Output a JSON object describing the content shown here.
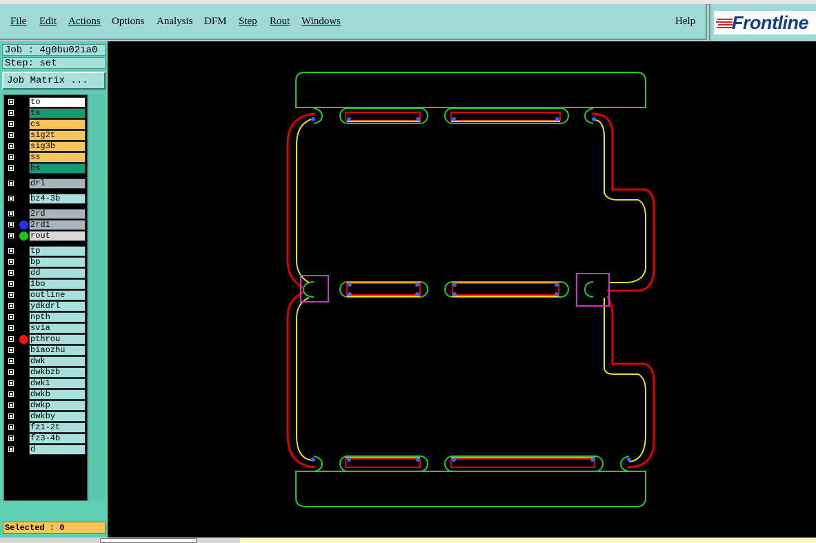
{
  "menu": {
    "file": "File",
    "edit": "Edit",
    "actions": "Actions",
    "options": "Options",
    "analysis": "Analysis",
    "dfm": "DFM",
    "step": "Step",
    "rout": "Rout",
    "windows": "Windows",
    "help": "Help"
  },
  "logo": {
    "text": "Frontline"
  },
  "job": {
    "job_label": "Job : 4g0bu02ia0",
    "step_label": "Step: set",
    "matrix_button": "Job Matrix ..."
  },
  "layers": [
    {
      "name": "to",
      "bg": "#ffffff",
      "dot": ""
    },
    {
      "name": "ts",
      "bg": "#159a72",
      "dot": ""
    },
    {
      "name": "cs",
      "bg": "#f8c45c",
      "dot": ""
    },
    {
      "name": "sig2t",
      "bg": "#f8c45c",
      "dot": ""
    },
    {
      "name": "sig3b",
      "bg": "#f8c45c",
      "dot": ""
    },
    {
      "name": "ss",
      "bg": "#f8c45c",
      "dot": ""
    },
    {
      "name": "bs",
      "bg": "#159a72",
      "dot": ""
    },
    {
      "name": "drl",
      "bg": "#a6b6ba",
      "dot": ""
    },
    {
      "name": "bz4-3b",
      "bg": "#a8e0dd",
      "dot": ""
    },
    {
      "name": "2rd",
      "bg": "#a6b6ba",
      "dot": ""
    },
    {
      "name": "2rd1",
      "bg": "#a6b6ba",
      "dot": "#2233ff"
    },
    {
      "name": "rout",
      "bg": "#d9d9d9",
      "dot": "#11cc11"
    },
    {
      "name": "tp",
      "bg": "#a8e0dd",
      "dot": ""
    },
    {
      "name": "bp",
      "bg": "#a8e0dd",
      "dot": ""
    },
    {
      "name": "dd",
      "bg": "#a8e0dd",
      "dot": ""
    },
    {
      "name": "1bo",
      "bg": "#a8e0dd",
      "dot": ""
    },
    {
      "name": "outline",
      "bg": "#a8e0dd",
      "dot": ""
    },
    {
      "name": "ydkdrl",
      "bg": "#a8e0dd",
      "dot": ""
    },
    {
      "name": "npth",
      "bg": "#a8e0dd",
      "dot": ""
    },
    {
      "name": "svia",
      "bg": "#a8e0dd",
      "dot": ""
    },
    {
      "name": "pthrou",
      "bg": "#a8e0dd",
      "dot": "#ff1111"
    },
    {
      "name": "biaozhu",
      "bg": "#a8e0dd",
      "dot": ""
    },
    {
      "name": "dwk",
      "bg": "#a8e0dd",
      "dot": ""
    },
    {
      "name": "dwkbzb",
      "bg": "#a8e0dd",
      "dot": ""
    },
    {
      "name": "dwk1",
      "bg": "#a8e0dd",
      "dot": ""
    },
    {
      "name": "dwkb",
      "bg": "#a8e0dd",
      "dot": ""
    },
    {
      "name": "dwkp",
      "bg": "#a8e0dd",
      "dot": ""
    },
    {
      "name": "dwkby",
      "bg": "#a8e0dd",
      "dot": ""
    },
    {
      "name": "fz1-2t",
      "bg": "#a8e0dd",
      "dot": ""
    },
    {
      "name": "fz3-4b",
      "bg": "#a8e0dd",
      "dot": ""
    },
    {
      "name": "d",
      "bg": "#a8e0dd",
      "dot": ""
    }
  ],
  "status": {
    "selected": "Selected : 0"
  },
  "colors": {
    "rout_green": "#22cc22",
    "route_red": "#e00000",
    "route_yellow": "#e8e020",
    "marker_magenta": "#d030d0",
    "pad_blue": "#4060ff"
  }
}
